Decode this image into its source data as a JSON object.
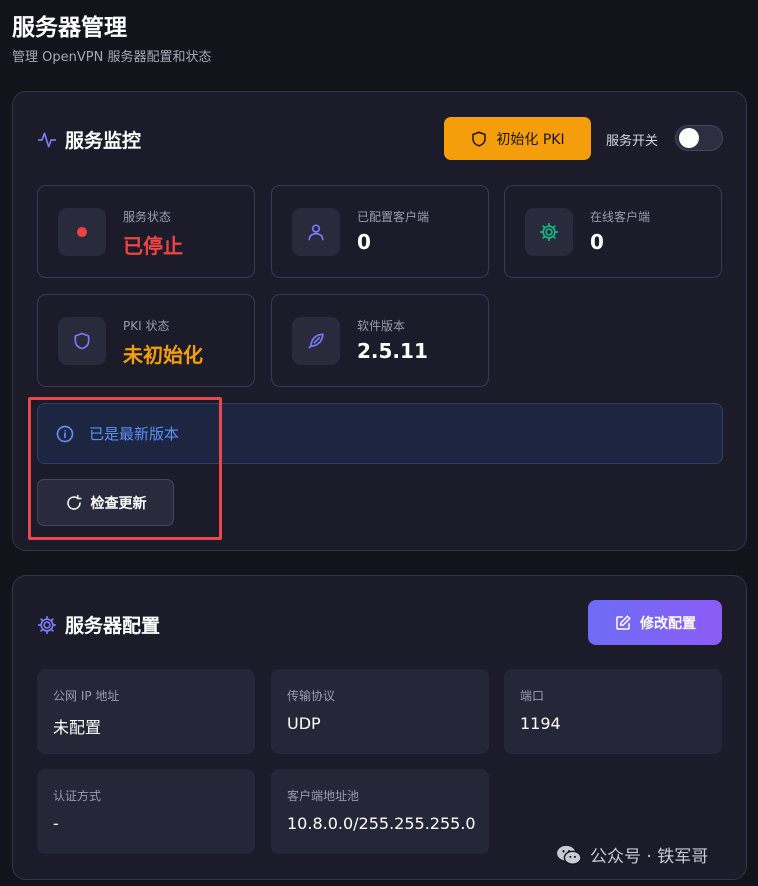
{
  "page": {
    "title": "服务器管理",
    "subtitle": "管理 OpenVPN 服务器配置和状态"
  },
  "monitor": {
    "title": "服务监控",
    "init_pki_label": "初始化 PKI",
    "service_switch_label": "服务开关",
    "service_switch_on": false,
    "stats": [
      {
        "label": "服务状态",
        "value": "已停止",
        "color": "#ef4444",
        "icon": "record-dot-icon"
      },
      {
        "label": "已配置客户端",
        "value": "0",
        "color": "#ffffff",
        "icon": "user-icon"
      },
      {
        "label": "在线客户端",
        "value": "0",
        "color": "#ffffff",
        "icon": "gear-icon"
      },
      {
        "label": "PKI 状态",
        "value": "未初始化",
        "color": "#f59e0b",
        "icon": "shield-icon"
      },
      {
        "label": "软件版本",
        "value": "2.5.11",
        "color": "#ffffff",
        "icon": "feather-icon"
      }
    ],
    "info_text": "已是最新版本",
    "check_update_label": "检查更新"
  },
  "config": {
    "title": "服务器配置",
    "edit_label": "修改配置",
    "items": [
      {
        "label": "公网 IP 地址",
        "value": "未配置"
      },
      {
        "label": "传输协议",
        "value": "UDP"
      },
      {
        "label": "端口",
        "value": "1194"
      },
      {
        "label": "认证方式",
        "value": "-"
      },
      {
        "label": "客户端地址池",
        "value": "10.8.0.0/255.255.255.0"
      }
    ]
  },
  "watermark": {
    "text": "公众号 · 铁军哥",
    "icon": "wechat-icon"
  },
  "colors": {
    "accent": "#6e6cf6",
    "warning": "#f59e0b",
    "danger": "#ef4444",
    "info": "#5e8ff7",
    "success": "#10b981"
  }
}
